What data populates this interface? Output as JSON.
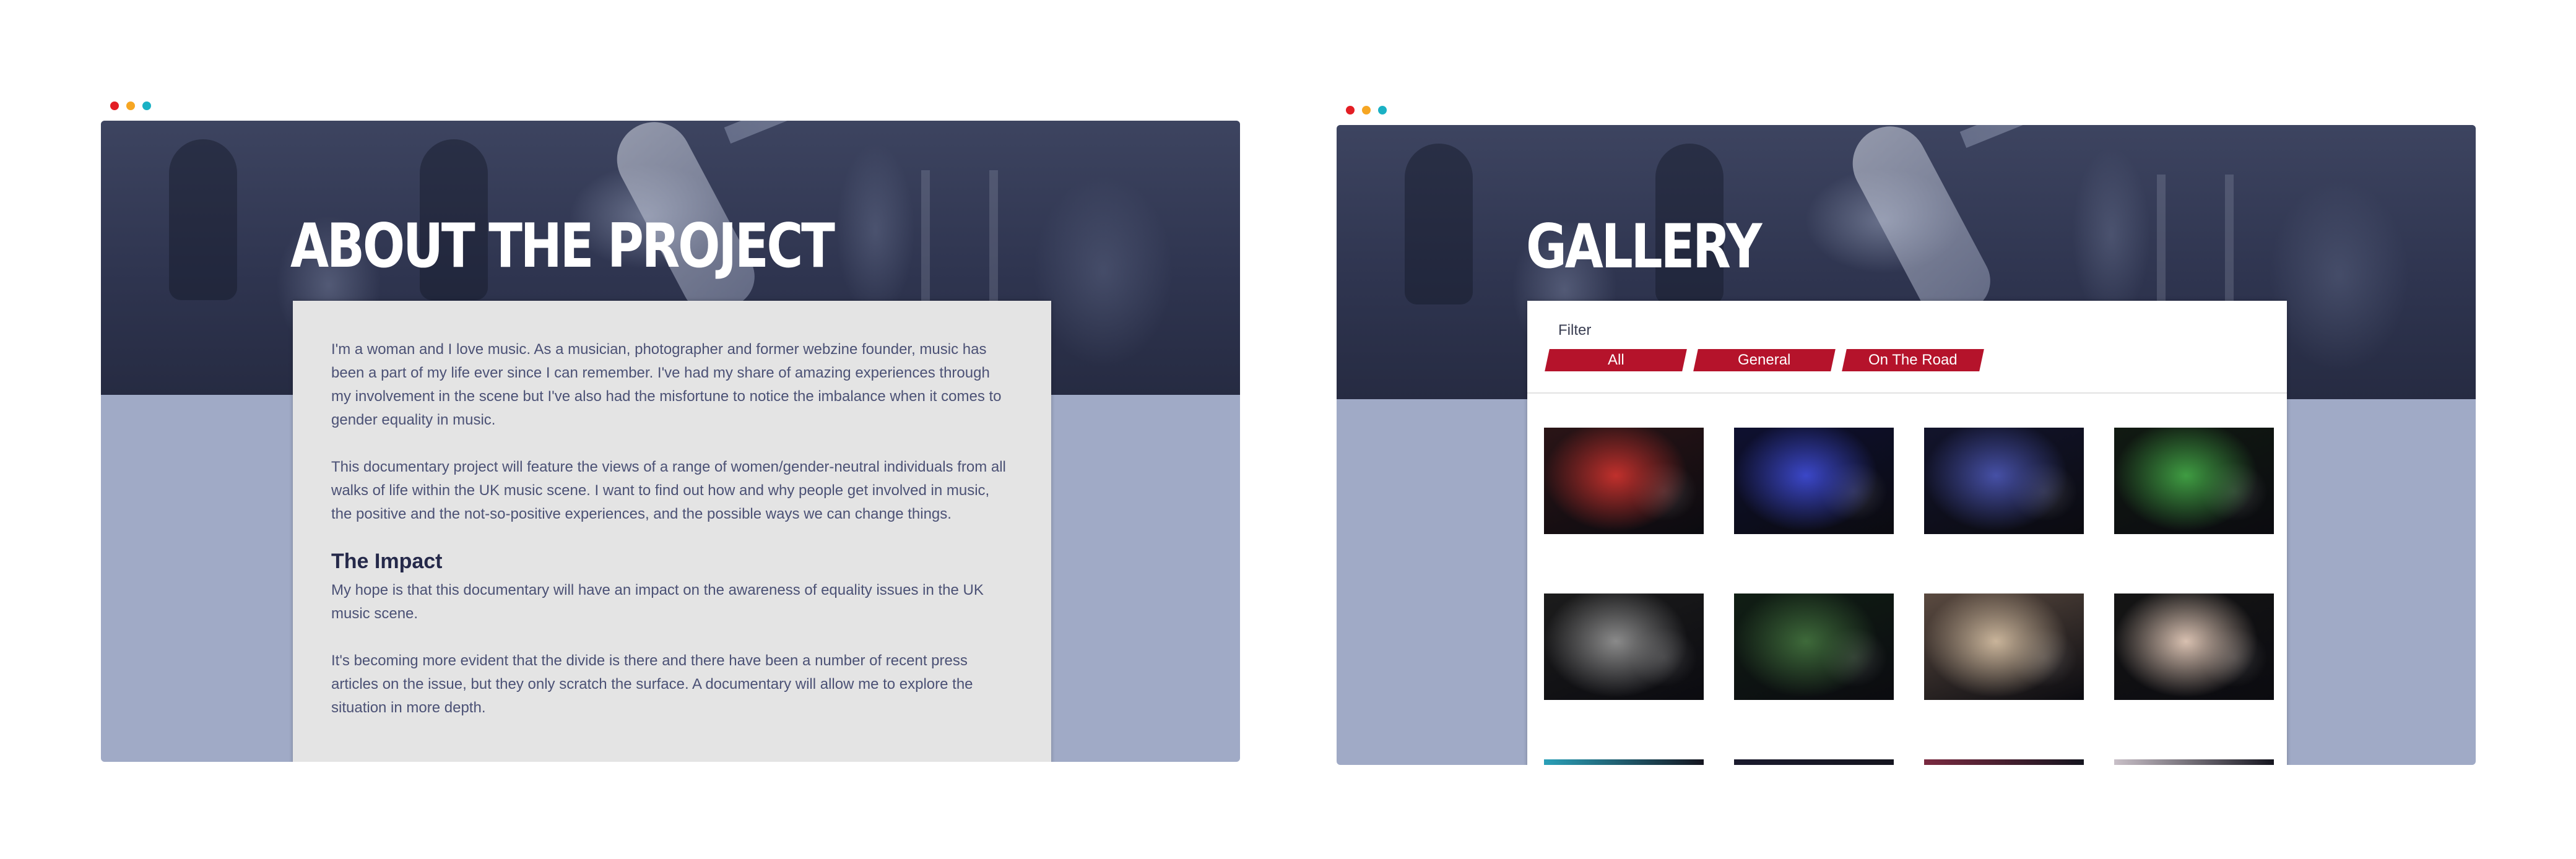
{
  "window_dot_colors": [
    "#e31e24",
    "#f6a623",
    "#1ab1c4"
  ],
  "about_page": {
    "title": "ABOUT THE PROJECT",
    "paragraphs": [
      "I'm a woman and I love music. As a musician, photographer and former webzine founder, music has been a part of my life ever since I can remember. I've had my share of amazing experiences through my involvement in the scene but I've also had the misfortune to notice the imbalance when it comes to gender equality in music.",
      "This documentary project will feature the views of a range of women/gender-neutral individuals from all walks of life within the UK music scene. I want to find out how and why people get involved in music, the positive and the not-so-positive experiences, and the possible ways we can change things."
    ],
    "impact_heading": "The Impact",
    "impact_paragraphs": [
      "My hope is that this documentary will have an impact on the awareness of equality issues in the UK music scene.",
      "It's becoming more evident that the divide is there and there have been a number of recent press articles on the issue, but they only scratch the surface. A documentary will allow me to explore the situation in more depth."
    ]
  },
  "gallery_page": {
    "title": "GALLERY",
    "filter_label": "Filter",
    "filters": [
      "All",
      "General",
      "On The Road"
    ],
    "photos": [
      {
        "name": "red-stage-band-photo",
        "c1": "#c0302c",
        "c2": "#2a1416"
      },
      {
        "name": "blue-singer-photo",
        "c1": "#3b47c8",
        "c2": "#0e1030"
      },
      {
        "name": "blue-guitarist-photo",
        "c1": "#4650a6",
        "c2": "#12142c"
      },
      {
        "name": "green-light-performer-photo",
        "c1": "#3f9c42",
        "c2": "#111a12"
      },
      {
        "name": "black-white-guitarist-photo",
        "c1": "#8a8a8a",
        "c2": "#1c1c1c"
      },
      {
        "name": "crowd-green-photo",
        "c1": "#3e6a3a",
        "c2": "#101e14"
      },
      {
        "name": "woman-seated-interview-photo",
        "c1": "#c9b49a",
        "c2": "#5a4a40"
      },
      {
        "name": "two-women-portrait-photo",
        "c1": "#d8c0b0",
        "c2": "#151515"
      }
    ]
  }
}
